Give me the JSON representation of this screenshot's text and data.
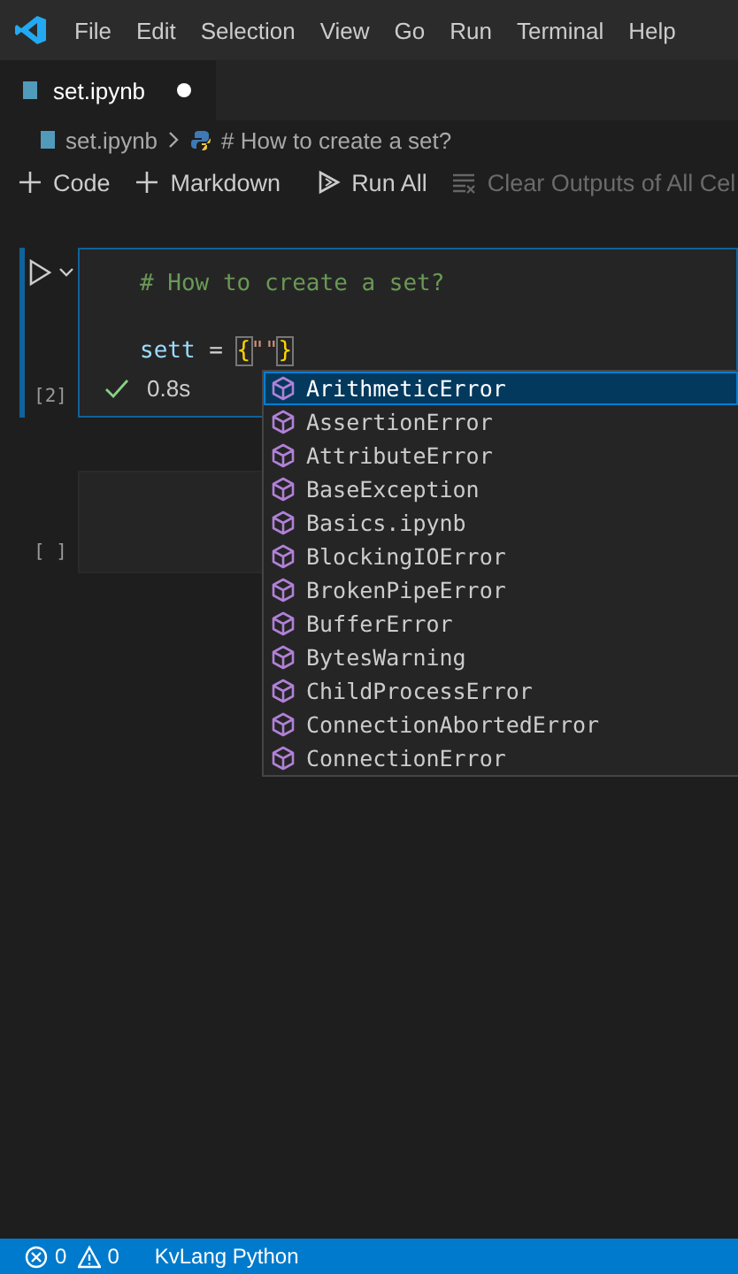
{
  "menu_bar": {
    "items": [
      "File",
      "Edit",
      "Selection",
      "View",
      "Go",
      "Run",
      "Terminal",
      "Help"
    ]
  },
  "tabs": [
    {
      "label": "set.ipynb",
      "selected": true,
      "modified": true
    }
  ],
  "breadcrumb": [
    "set.ipynb",
    "# How to create a set?"
  ],
  "toolbar": [
    {
      "kind": "add",
      "label": "Code",
      "disabled": false
    },
    {
      "kind": "add",
      "label": "Markdown",
      "disabled": false
    },
    {
      "kind": "run",
      "label": "Run All",
      "disabled": false
    },
    {
      "kind": "clear",
      "label": "Clear Outputs of All Cel",
      "disabled": true
    }
  ],
  "cells": [
    {
      "selected": true,
      "exec_count": "[2]",
      "lines": [
        {
          "tokens": [
            {
              "kind": "comment",
              "text": "# How to create a set?"
            }
          ]
        },
        {
          "tokens": [
            {
              "kind": "var",
              "text": "sett"
            },
            {
              "kind": "op",
              "text": " = "
            },
            {
              "kind": "brace",
              "text": "{"
            },
            {
              "kind": "string",
              "text": "\"\""
            },
            {
              "kind": "brace",
              "text": "}"
            }
          ]
        }
      ],
      "status": {
        "succeeded": true,
        "time": "0.8s"
      }
    },
    {
      "selected": false,
      "exec_count": "[ ]"
    }
  ],
  "suggestions": [
    {
      "label": "ArithmeticError",
      "selected": true
    },
    {
      "label": "AssertionError",
      "selected": false
    },
    {
      "label": "AttributeError",
      "selected": false
    },
    {
      "label": "BaseException",
      "selected": false
    },
    {
      "label": "Basics.ipynb",
      "selected": false
    },
    {
      "label": "BlockingIOError",
      "selected": false
    },
    {
      "label": "BrokenPipeError",
      "selected": false
    },
    {
      "label": "BufferError",
      "selected": false
    },
    {
      "label": "BytesWarning",
      "selected": false
    },
    {
      "label": "ChildProcessError",
      "selected": false
    },
    {
      "label": "ConnectionAbortedError",
      "selected": false
    },
    {
      "label": "ConnectionError",
      "selected": false
    }
  ],
  "status_bar": {
    "errors": "0",
    "warnings": "0",
    "language": "KvLang Python"
  }
}
